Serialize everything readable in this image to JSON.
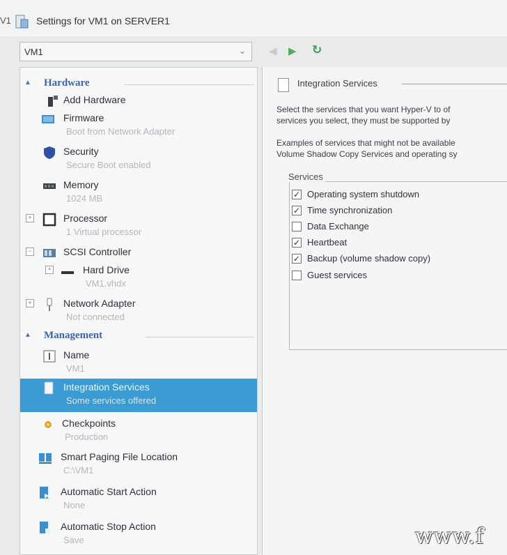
{
  "window": {
    "title": "Settings for VM1 on SERVER1",
    "stub": "V1"
  },
  "vm_select": {
    "value": "VM1"
  },
  "hardware": {
    "label": "Hardware",
    "items": [
      {
        "primary": "Add Hardware",
        "secondary": ""
      },
      {
        "primary": "Firmware",
        "secondary": "Boot from Network Adapter"
      },
      {
        "primary": "Security",
        "secondary": "Secure Boot enabled"
      },
      {
        "primary": "Memory",
        "secondary": "1024 MB"
      },
      {
        "primary": "Processor",
        "secondary": "1 Virtual processor"
      },
      {
        "primary": "SCSI Controller",
        "secondary": ""
      },
      {
        "primary": "Hard Drive",
        "secondary": "VM1.vhdx"
      },
      {
        "primary": "Network Adapter",
        "secondary": "Not connected"
      }
    ]
  },
  "management": {
    "label": "Management",
    "items": [
      {
        "primary": "Name",
        "secondary": "VM1"
      },
      {
        "primary": "Integration Services",
        "secondary": "Some services offered"
      },
      {
        "primary": "Checkpoints",
        "secondary": "Production"
      },
      {
        "primary": "Smart Paging File Location",
        "secondary": "C:\\VM1"
      },
      {
        "primary": "Automatic Start Action",
        "secondary": "None"
      },
      {
        "primary": "Automatic Stop Action",
        "secondary": "Save"
      }
    ]
  },
  "panel": {
    "header": "Integration Services",
    "desc1": "Select the services that you want Hyper-V to of",
    "desc2": "services you select, they must be supported by",
    "ex1": "Examples of services that might not be available",
    "ex2": "Volume Shadow Copy Services and operating sy",
    "services_label": "Services",
    "services": [
      {
        "label": "Operating system shutdown",
        "checked": true
      },
      {
        "label": "Time synchronization",
        "checked": true
      },
      {
        "label": "Data Exchange",
        "checked": false
      },
      {
        "label": "Heartbeat",
        "checked": true
      },
      {
        "label": "Backup (volume shadow copy)",
        "checked": true
      },
      {
        "label": "Guest services",
        "checked": false
      }
    ]
  },
  "watermark": "www.f"
}
